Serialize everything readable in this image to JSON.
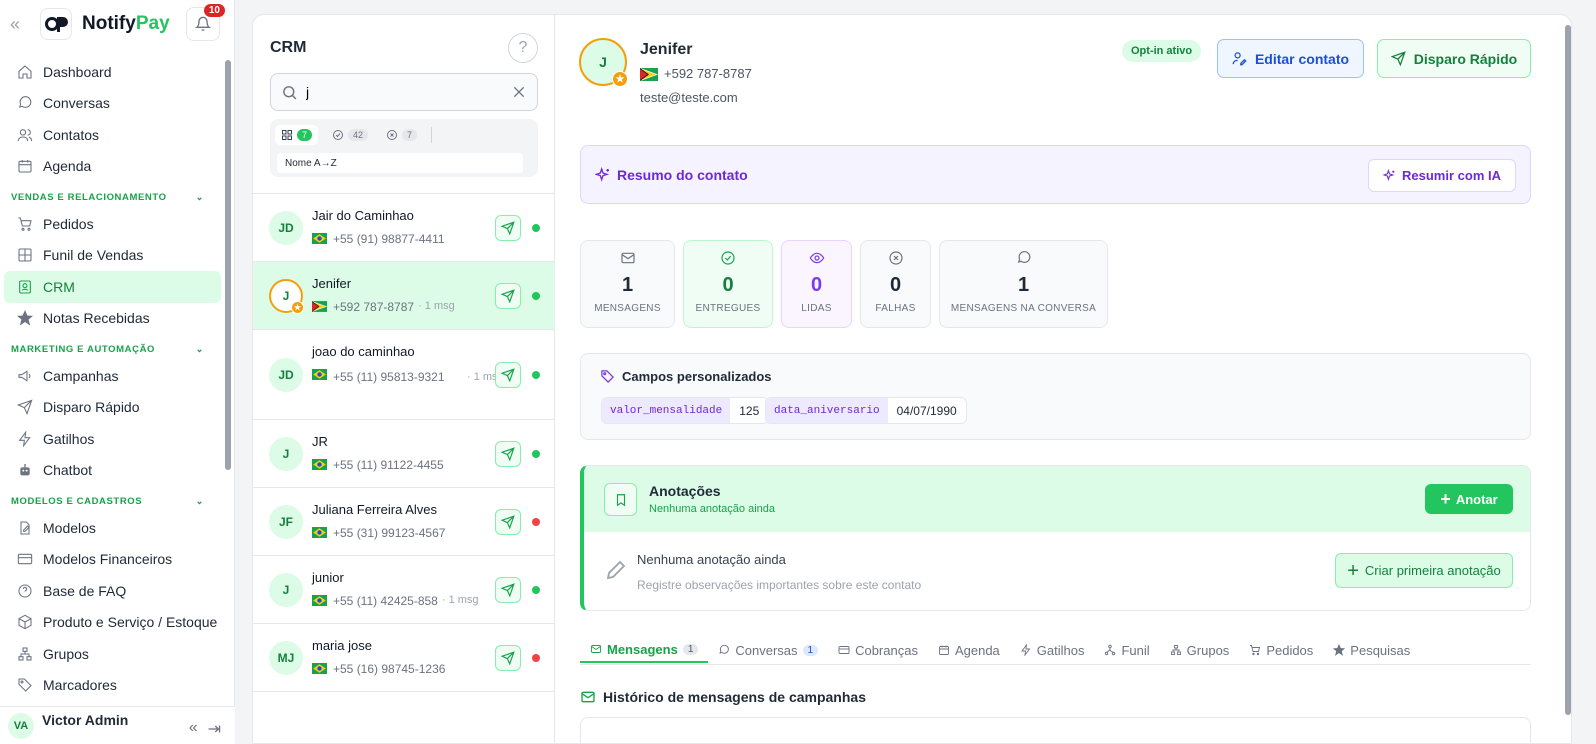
{
  "brand": {
    "name_part1": "Notify",
    "name_part2": "Pay",
    "notifications": "10"
  },
  "nav": {
    "top": [
      {
        "label": "Dashboard",
        "icon": "home-icon"
      },
      {
        "label": "Conversas",
        "icon": "chat-icon"
      },
      {
        "label": "Contatos",
        "icon": "users-icon"
      },
      {
        "label": "Agenda",
        "icon": "calendar-icon"
      }
    ],
    "section1": "VENDAS E RELACIONAMENTO",
    "sales": [
      {
        "label": "Pedidos",
        "icon": "cart-icon"
      },
      {
        "label": "Funil de Vendas",
        "icon": "grid-icon"
      },
      {
        "label": "CRM",
        "icon": "contact-card-icon"
      },
      {
        "label": "Notas Recebidas",
        "icon": "star-icon"
      }
    ],
    "section2": "MARKETING E AUTOMAÇÃO",
    "marketing": [
      {
        "label": "Campanhas",
        "icon": "megaphone-icon"
      },
      {
        "label": "Disparo Rápido",
        "icon": "send-icon"
      },
      {
        "label": "Gatilhos",
        "icon": "bolt-icon"
      },
      {
        "label": "Chatbot",
        "icon": "robot-icon"
      }
    ],
    "section3": "MODELOS E CADASTROS",
    "models": [
      {
        "label": "Modelos",
        "icon": "file-edit-icon"
      },
      {
        "label": "Modelos Financeiros",
        "icon": "card-icon"
      },
      {
        "label": "Base de FAQ",
        "icon": "help-circle-icon"
      },
      {
        "label": "Produto e Serviço / Estoque",
        "icon": "box-icon"
      },
      {
        "label": "Grupos",
        "icon": "network-icon"
      },
      {
        "label": "Marcadores",
        "icon": "tag-icon"
      }
    ]
  },
  "user": {
    "initials": "VA",
    "name": "Victor Admin"
  },
  "crm": {
    "title": "CRM",
    "search_value": "j",
    "filters": {
      "all": "7",
      "done": "42",
      "failed": "7"
    },
    "sort": "Nome A→Z",
    "contacts": [
      {
        "initials": "JD",
        "name": "Jair do Caminhao",
        "phone": "+55 (91) 98877-4411",
        "msgs": "",
        "flag": "br",
        "status": "#22c55e"
      },
      {
        "initials": "J",
        "name": "Jenifer",
        "phone": "+592 787-8787",
        "msgs": "· 1 msg",
        "flag": "gy",
        "status": "#22c55e"
      },
      {
        "initials": "JD",
        "name": "joao do caminhao",
        "phone": "+55 (11) 95813-9321",
        "msgs": "· 1 msg",
        "flag": "br",
        "status": "#22c55e"
      },
      {
        "initials": "J",
        "name": "JR",
        "phone": "+55 (11) 91122-4455",
        "msgs": "",
        "flag": "br",
        "status": "#22c55e"
      },
      {
        "initials": "JF",
        "name": "Juliana Ferreira Alves",
        "phone": "+55 (31) 99123-4567",
        "msgs": "",
        "flag": "br",
        "status": "#ef4444"
      },
      {
        "initials": "J",
        "name": "junior",
        "phone": "+55 (11) 42425-858",
        "msgs": "· 1 msg",
        "flag": "br",
        "status": "#22c55e"
      },
      {
        "initials": "MJ",
        "name": "maria jose",
        "phone": "+55 (16) 98745-1236",
        "msgs": "",
        "flag": "br",
        "status": "#ef4444"
      }
    ]
  },
  "detail": {
    "initial": "J",
    "name": "Jenifer",
    "phone": "+592 787-8787",
    "email": "teste@teste.com",
    "optin": "Opt-in ativo",
    "edit_label": "Editar contato",
    "quick_label": "Disparo Rápido",
    "summary_title": "Resumo do contato",
    "ai_label": "Resumir com IA",
    "stats": [
      {
        "value": "1",
        "label": "MENSAGENS"
      },
      {
        "value": "0",
        "label": "ENTREGUES"
      },
      {
        "value": "0",
        "label": "LIDAS"
      },
      {
        "value": "0",
        "label": "FALHAS"
      },
      {
        "value": "1",
        "label": "MENSAGENS NA CONVERSA"
      }
    ],
    "custom_title": "Campos personalizados",
    "fields": [
      {
        "key": "valor_mensalidade",
        "value": "125"
      },
      {
        "key": "data_aniversario",
        "value": "04/07/1990"
      }
    ],
    "notes_title": "Anotações",
    "notes_sub": "Nenhuma anotação ainda",
    "notes_btn": "Anotar",
    "empty_title": "Nenhuma anotação ainda",
    "empty_sub": "Registre observações importantes sobre este contato",
    "first_btn": "Criar primeira anotação",
    "tabs": [
      {
        "label": "Mensagens",
        "badge": "1"
      },
      {
        "label": "Conversas",
        "badge": "1"
      },
      {
        "label": "Cobranças",
        "badge": ""
      },
      {
        "label": "Agenda",
        "badge": ""
      },
      {
        "label": "Gatilhos",
        "badge": ""
      },
      {
        "label": "Funil",
        "badge": ""
      },
      {
        "label": "Grupos",
        "badge": ""
      },
      {
        "label": "Pedidos",
        "badge": ""
      },
      {
        "label": "Pesquisas",
        "badge": ""
      }
    ],
    "history_title": "Histórico de mensagens de campanhas"
  }
}
